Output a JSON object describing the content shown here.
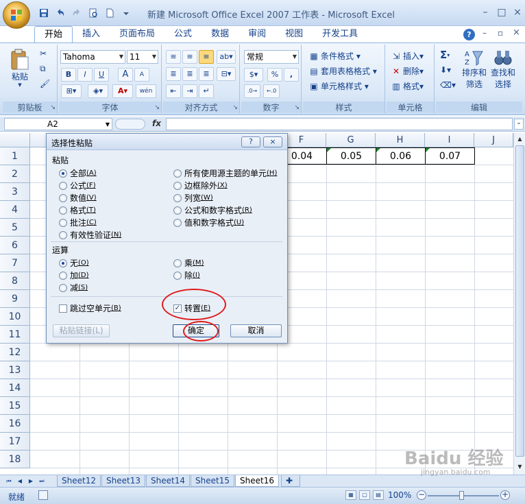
{
  "window": {
    "title": "新建 Microsoft Office Excel 2007 工作表 - Microsoft Excel",
    "minimize": "–",
    "restore": "□",
    "close": "×"
  },
  "qat": [
    "save-icon",
    "undo-icon",
    "redo-icon",
    "print-preview-icon",
    "new-icon",
    "more-icon"
  ],
  "tabs": [
    "开始",
    "插入",
    "页面布局",
    "公式",
    "数据",
    "审阅",
    "视图",
    "开发工具"
  ],
  "active_tab": "开始",
  "ribbon": {
    "clipboard": {
      "title": "剪贴板",
      "paste": "粘贴"
    },
    "font": {
      "title": "字体",
      "font_name": "Tahoma",
      "font_size": "11",
      "bold": "B",
      "italic": "I",
      "underline": "U",
      "grow": "A",
      "shrink": "A",
      "phonetic": "wén"
    },
    "alignment": {
      "title": "对齐方式"
    },
    "number": {
      "title": "数字",
      "format": "常规",
      "currency": "$",
      "percent": "%",
      "comma": ","
    },
    "styles": {
      "title": "样式",
      "conditional": "条件格式",
      "table": "套用表格格式",
      "cell": "单元格样式"
    },
    "cells": {
      "title": "单元格",
      "insert": "插入",
      "delete": "删除",
      "format": "格式"
    },
    "editing": {
      "title": "编辑",
      "sum": "Σ",
      "sort": "排序和\n筛选",
      "find": "查找和\n选择",
      "sort1": "排序和",
      "sort2": "筛选",
      "find1": "查找和",
      "find2": "选择"
    }
  },
  "formula_bar": {
    "name_box": "A2",
    "fx": "fx",
    "value": ""
  },
  "grid": {
    "columns": [
      "F",
      "G",
      "H",
      "I",
      "J"
    ],
    "rows": [
      "1",
      "2",
      "3",
      "4",
      "5",
      "6",
      "7",
      "8",
      "9",
      "10",
      "11",
      "12",
      "13",
      "14",
      "15",
      "16",
      "17",
      "18"
    ],
    "row1_values": [
      "0.04",
      "0.05",
      "0.06",
      "0.07"
    ]
  },
  "sheets": [
    "Sheet12",
    "Sheet13",
    "Sheet14",
    "Sheet15",
    "Sheet16"
  ],
  "active_sheet": "Sheet16",
  "status": {
    "text": "就绪",
    "zoom": "100%"
  },
  "watermark": {
    "brand": "Baidu 经验",
    "url": "jingyan.baidu.com"
  },
  "dialog": {
    "title": "选择性粘贴",
    "help": "?",
    "close": "×",
    "paste_section": "粘贴",
    "paste_options_left": [
      {
        "label": "全部",
        "key": "A",
        "checked": true
      },
      {
        "label": "公式",
        "key": "F",
        "checked": false
      },
      {
        "label": "数值",
        "key": "V",
        "checked": false
      },
      {
        "label": "格式",
        "key": "T",
        "checked": false
      },
      {
        "label": "批注",
        "key": "C",
        "checked": false
      },
      {
        "label": "有效性验证",
        "key": "N",
        "checked": false
      }
    ],
    "paste_options_right": [
      {
        "label": "所有使用源主题的单元",
        "key": "H",
        "checked": false
      },
      {
        "label": "边框除外",
        "key": "X",
        "checked": false
      },
      {
        "label": "列宽",
        "key": "W",
        "checked": false
      },
      {
        "label": "公式和数字格式",
        "key": "R",
        "checked": false
      },
      {
        "label": "值和数字格式",
        "key": "U",
        "checked": false
      }
    ],
    "operation_section": "运算",
    "operation_left": [
      {
        "label": "无",
        "key": "O",
        "checked": true
      },
      {
        "label": "加",
        "key": "D",
        "checked": false
      },
      {
        "label": "减",
        "key": "S",
        "checked": false
      }
    ],
    "operation_right": [
      {
        "label": "乘",
        "key": "M",
        "checked": false
      },
      {
        "label": "除",
        "key": "I",
        "checked": false
      }
    ],
    "skip_blanks": {
      "label": "跳过空单元",
      "key": "B",
      "checked": false
    },
    "transpose": {
      "label": "转置",
      "key": "E",
      "checked": true
    },
    "paste_link": "粘贴链接(L)",
    "ok": "确定",
    "cancel": "取消"
  },
  "colors": {
    "annotation": "#e01b1b",
    "accent": "#15428b",
    "green_marker": "#1e8a2e"
  }
}
